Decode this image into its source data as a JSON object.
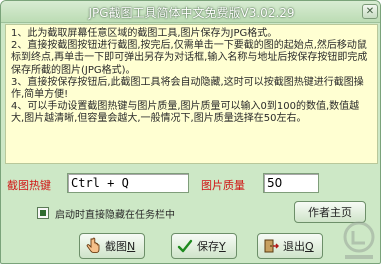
{
  "window": {
    "title": "JPG截图工具简体中文免费版V3.02.29"
  },
  "info_lines": [
    "1、此为截取屏幕任意区域的截图工具,图片保存为JPG格式。",
    "2、直接按截图按钮进行截图,按完后,仅需单击一下要截的图的起始点,然后移动鼠标到终点,再单击一下即可弹出另存为对话框,输入名称与地址后按保存按钮即完成保存所截的图片(JPG格式)。",
    "3、直接按保存按钮后,此截图工具将会自动隐藏,这时可以按截图热键进行截图操作,简单方便!",
    "4、可以手动设置截图热键与图片质量,图片质量可以输入0到100的数值,数值越大,图片越清晰,但容量会越大,一般情况下,图片质量选择在50左右。"
  ],
  "settings": {
    "hotkey_label": "截图热键",
    "hotkey_value": "Ctrl + Q",
    "quality_label": "图片质量",
    "quality_value": "50",
    "hide_on_start_label": "启动时直接隐藏在任务栏中",
    "hide_on_start_checked": true
  },
  "buttons": {
    "author_home": "作者主页",
    "capture": "截图",
    "capture_key": "N",
    "save": "保存",
    "save_key": "Y",
    "exit": "退出",
    "exit_key": "Q"
  },
  "icons": {
    "close": "close-icon",
    "capture": "hand-pointer-icon",
    "save": "checkmark-icon",
    "exit": "exit-door-icon",
    "watermark": "site-watermark-logo"
  },
  "colors": {
    "window_bg": "#cde8c6",
    "info_bg": "#ffffd2",
    "label_red": "#d11414"
  }
}
